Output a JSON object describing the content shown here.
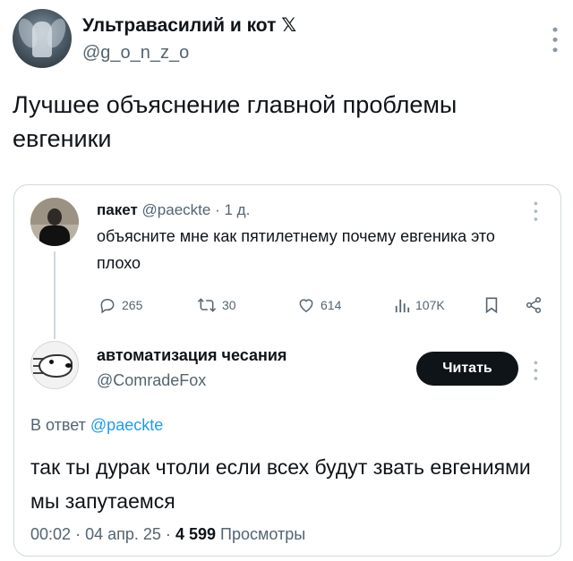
{
  "outer": {
    "author_name": "Ультравасилий и кот",
    "x_logo": "𝕏",
    "handle": "@g_o_n_z_o",
    "text": "Лучшее объяснение главной проблемы евгеники"
  },
  "quoted": {
    "author_name": "пакет",
    "handle": "@paeckte",
    "separator": "·",
    "time": "1 д.",
    "text": "объясните мне как пятилетнему почему евгеника это плохо",
    "actions": {
      "replies": "265",
      "reposts": "30",
      "likes": "614",
      "views": "107K"
    }
  },
  "reply": {
    "author_name": "автоматизация чесания",
    "handle": "@ComradeFox",
    "follow_label": "Читать",
    "reply_to_prefix": "В ответ",
    "reply_to_mention": "@paeckte",
    "text": "так ты дурак чтоли если всех будут звать евгениями мы запутаемся",
    "time": "00:02",
    "date": "04 апр. 25",
    "views_count": "4 599",
    "views_label": "Просмотры",
    "sep": "·"
  },
  "colors": {
    "text": "#0f1419",
    "muted": "#536471",
    "link": "#1d9bf0",
    "border": "#cfd9de",
    "button_bg": "#0f1419"
  },
  "icons": [
    "more-vertical-icon",
    "reply-icon",
    "repost-icon",
    "like-icon",
    "views-icon",
    "bookmark-icon",
    "share-icon"
  ]
}
